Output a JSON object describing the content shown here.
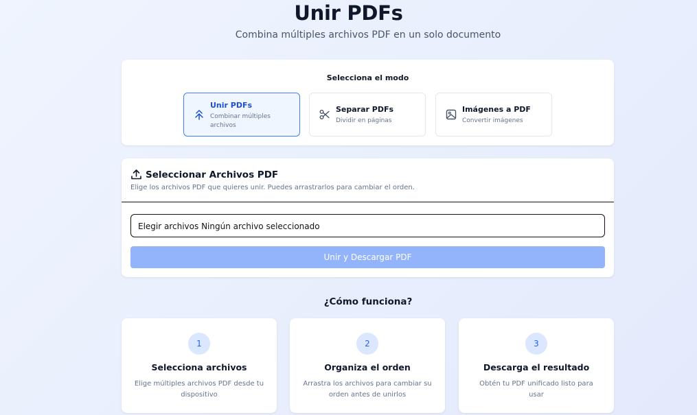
{
  "header": {
    "title": "Unir PDFs",
    "subtitle": "Combina múltiples archivos PDF en un solo documento"
  },
  "mode_selector": {
    "heading": "Selecciona el modo",
    "options": [
      {
        "label": "Unir PDFs",
        "desc_line1": "Combinar múltiples",
        "desc_line2": "archivos",
        "icon": "merge-icon",
        "active": true
      },
      {
        "label": "Separar PDFs",
        "desc_line1": "Dividir en páginas",
        "icon": "scissors-icon",
        "active": false
      },
      {
        "label": "Imágenes a PDF",
        "desc_line1": "Convertir imágenes",
        "icon": "image-icon",
        "active": false
      }
    ]
  },
  "upload": {
    "title": "Seleccionar Archivos PDF",
    "description": "Elige los archivos PDF que quieres unir. Puedes arrastrarlos para cambiar el orden.",
    "file_input_text": "Elegir archivos Ningún archivo seleccionado",
    "merge_button": "Unir y Descargar PDF"
  },
  "how_it_works": {
    "title": "¿Cómo funciona?",
    "steps": [
      {
        "number": "1",
        "title": "Selecciona archivos",
        "desc_line1": "Elige múltiples archivos PDF desde tu",
        "desc_line2": "dispositivo"
      },
      {
        "number": "2",
        "title": "Organiza el orden",
        "desc_line1": "Arrastra los archivos para cambiar su",
        "desc_line2": "orden antes de unirlos"
      },
      {
        "number": "3",
        "title": "Descarga el resultado",
        "desc_line1": "Obtén tu PDF unificado listo para",
        "desc_line2": "usar"
      }
    ]
  },
  "colors": {
    "accent": "#2563eb",
    "active_border": "#3b82f6",
    "button_disabled": "#93b4fb",
    "step_badge_bg": "#dbe7fe"
  }
}
